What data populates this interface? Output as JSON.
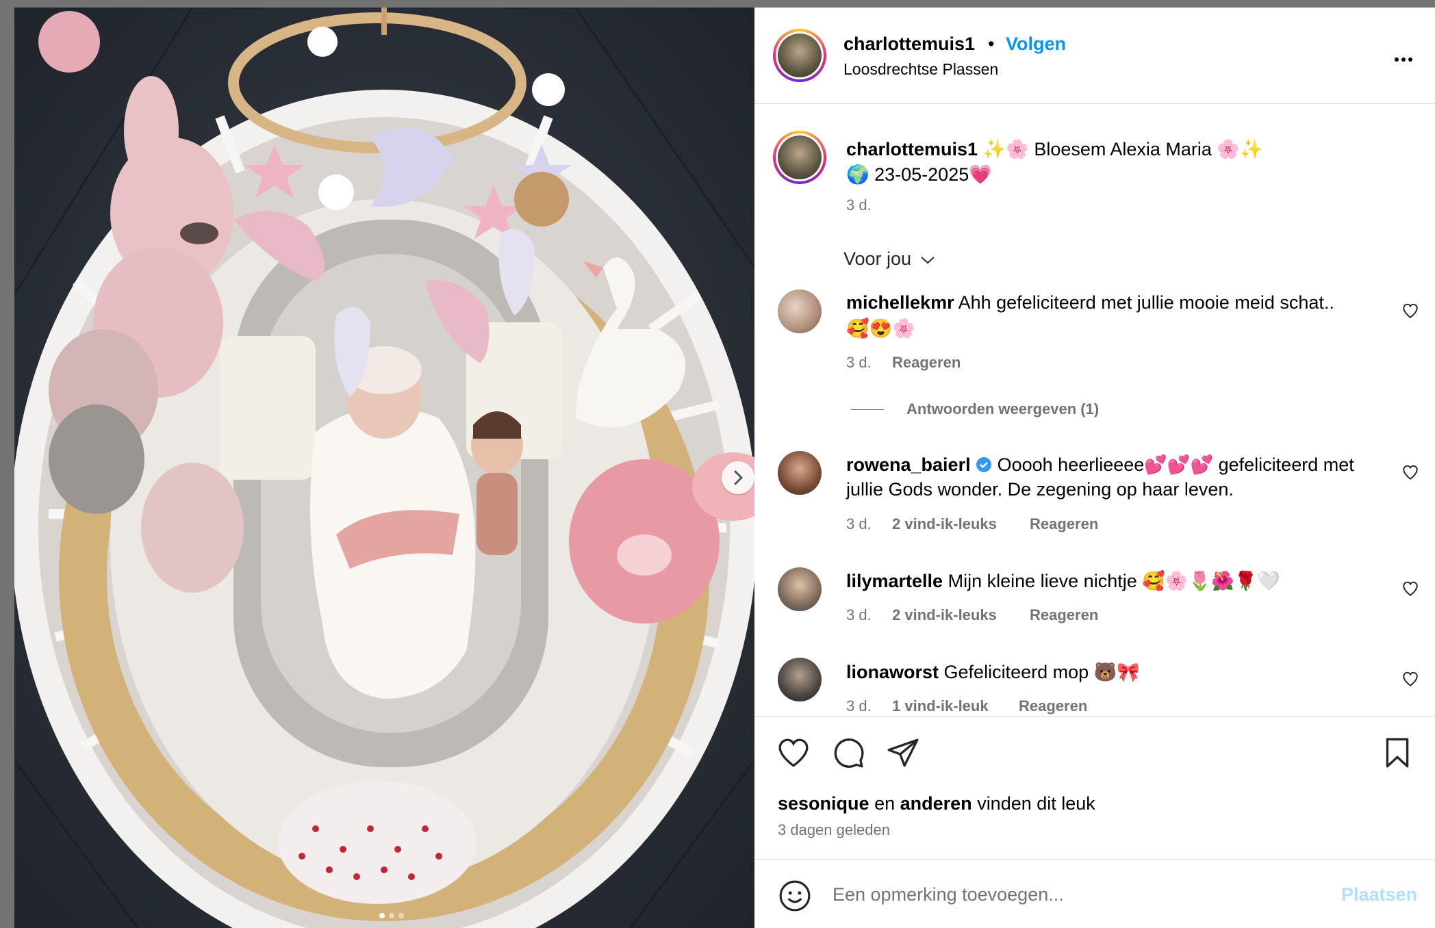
{
  "post": {
    "username": "charlottemuis1",
    "follow_label": "Volgen",
    "location": "Loosdrechtse Plassen",
    "caption_line1": "✨🌸 Bloesem Alexia Maria 🌸✨",
    "caption_line2": "🌍 23-05-2025💗",
    "caption_time": "3 d.",
    "sort_label": "Voor jou"
  },
  "comments": [
    {
      "username": "michellekmr",
      "text": "Ahh gefeliciteerd met jullie mooie meid schat..",
      "text2": "🥰😍🌸",
      "time": "3 d.",
      "likes": "",
      "reply": "Reageren",
      "view_replies": "Antwoorden weergeven (1)"
    },
    {
      "username": "rowena_baierl",
      "text": "Ooooh heerlieeee💕💕💕 gefeliciteerd met",
      "text2": "jullie Gods wonder. De zegening op haar leven.",
      "time": "3 d.",
      "likes": "2 vind-ik-leuks",
      "reply": "Reageren"
    },
    {
      "username": "lilymartelle",
      "text": "Mijn kleine lieve nichtje 🥰🌸🌷🌺🌹🤍",
      "time": "3 d.",
      "likes": "2 vind-ik-leuks",
      "reply": "Reageren"
    },
    {
      "username": "lionaworst",
      "text": "Gefeliciteerd mop 🐻🎀",
      "time": "3 d.",
      "likes": "1 vind-ik-leuk",
      "reply": "Reageren"
    }
  ],
  "likes_line": {
    "user": "sesonique",
    "and": "en",
    "others": "anderen",
    "suffix": "vinden dit leuk",
    "date": "3 dagen geleden"
  },
  "comment_box": {
    "placeholder": "Een opmerking toevoegen...",
    "post_label": "Plaatsen"
  },
  "colors": {
    "accent": "#0095f6",
    "secondary_text": "#737373",
    "verified": "#3897f0"
  },
  "icons": [
    "heart-icon",
    "comment-icon",
    "share-icon",
    "bookmark-icon",
    "emoji-icon",
    "more-icon",
    "chevron-down-icon",
    "chevron-right-icon",
    "verified-icon"
  ]
}
